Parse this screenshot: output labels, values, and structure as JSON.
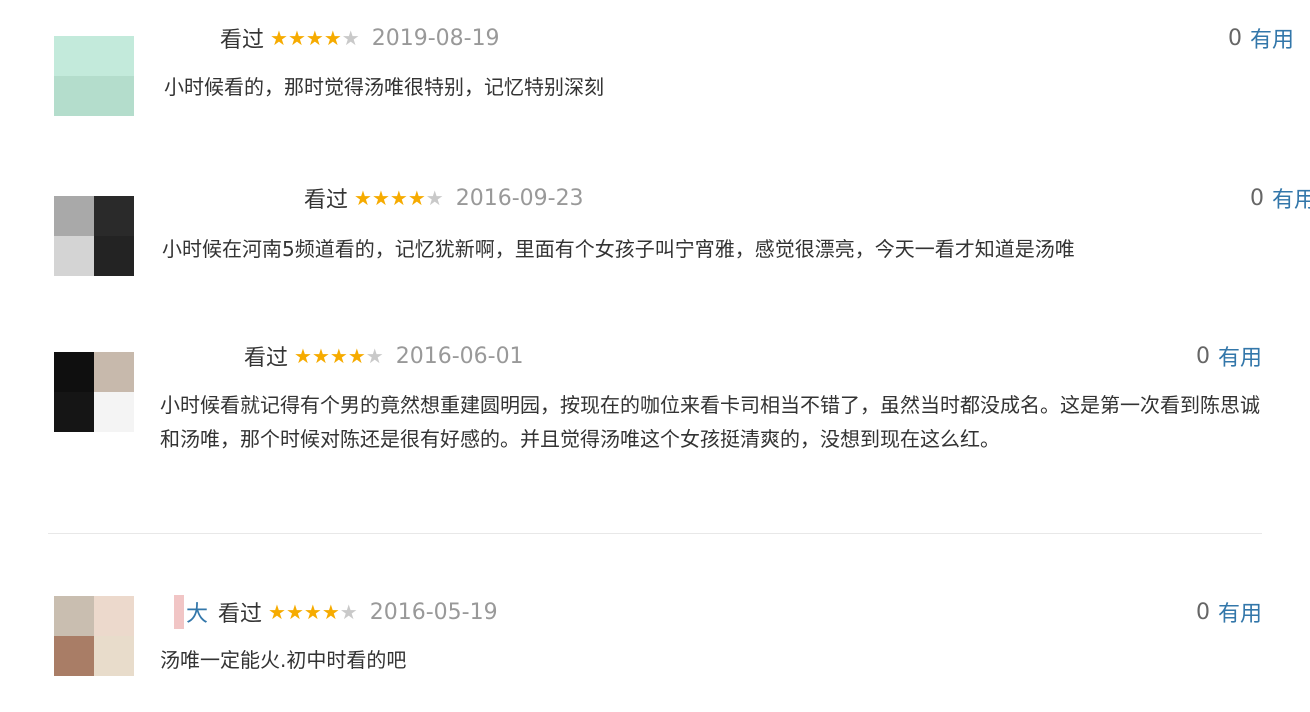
{
  "reviews": [
    {
      "username": "",
      "watched": "看过",
      "rating": 4,
      "date": "2019-08-19",
      "helpful_count": "0",
      "helpful_label": "有用",
      "content": "小时候看的，那时觉得汤唯很特别，记忆特别深刻"
    },
    {
      "username": "",
      "watched": "看过",
      "rating": 4,
      "date": "2016-09-23",
      "helpful_count": "0",
      "helpful_label": "有用",
      "content": "小时候在河南5频道看的，记忆犹新啊，里面有个女孩子叫宁宵雅，感觉很漂亮，今天一看才知道是汤唯"
    },
    {
      "username": "",
      "watched": "看过",
      "rating": 4,
      "date": "2016-06-01",
      "helpful_count": "0",
      "helpful_label": "有用",
      "content": "小时候看就记得有个男的竟然想重建圆明园，按现在的咖位来看卡司相当不错了，虽然当时都没成名。这是第一次看到陈思诚和汤唯，那个时候对陈还是很有好感的。并且觉得汤唯这个女孩挺清爽的，没想到现在这么红。"
    },
    {
      "username": "大",
      "watched": "看过",
      "rating": 4,
      "date": "2016-05-19",
      "helpful_count": "0",
      "helpful_label": "有用",
      "content": "汤唯一定能火.初中时看的吧"
    }
  ],
  "colors": {
    "link": "#3377aa",
    "star_on": "#f6ab00",
    "star_off": "#c9c9c9",
    "date": "#999999",
    "text": "#333333"
  }
}
